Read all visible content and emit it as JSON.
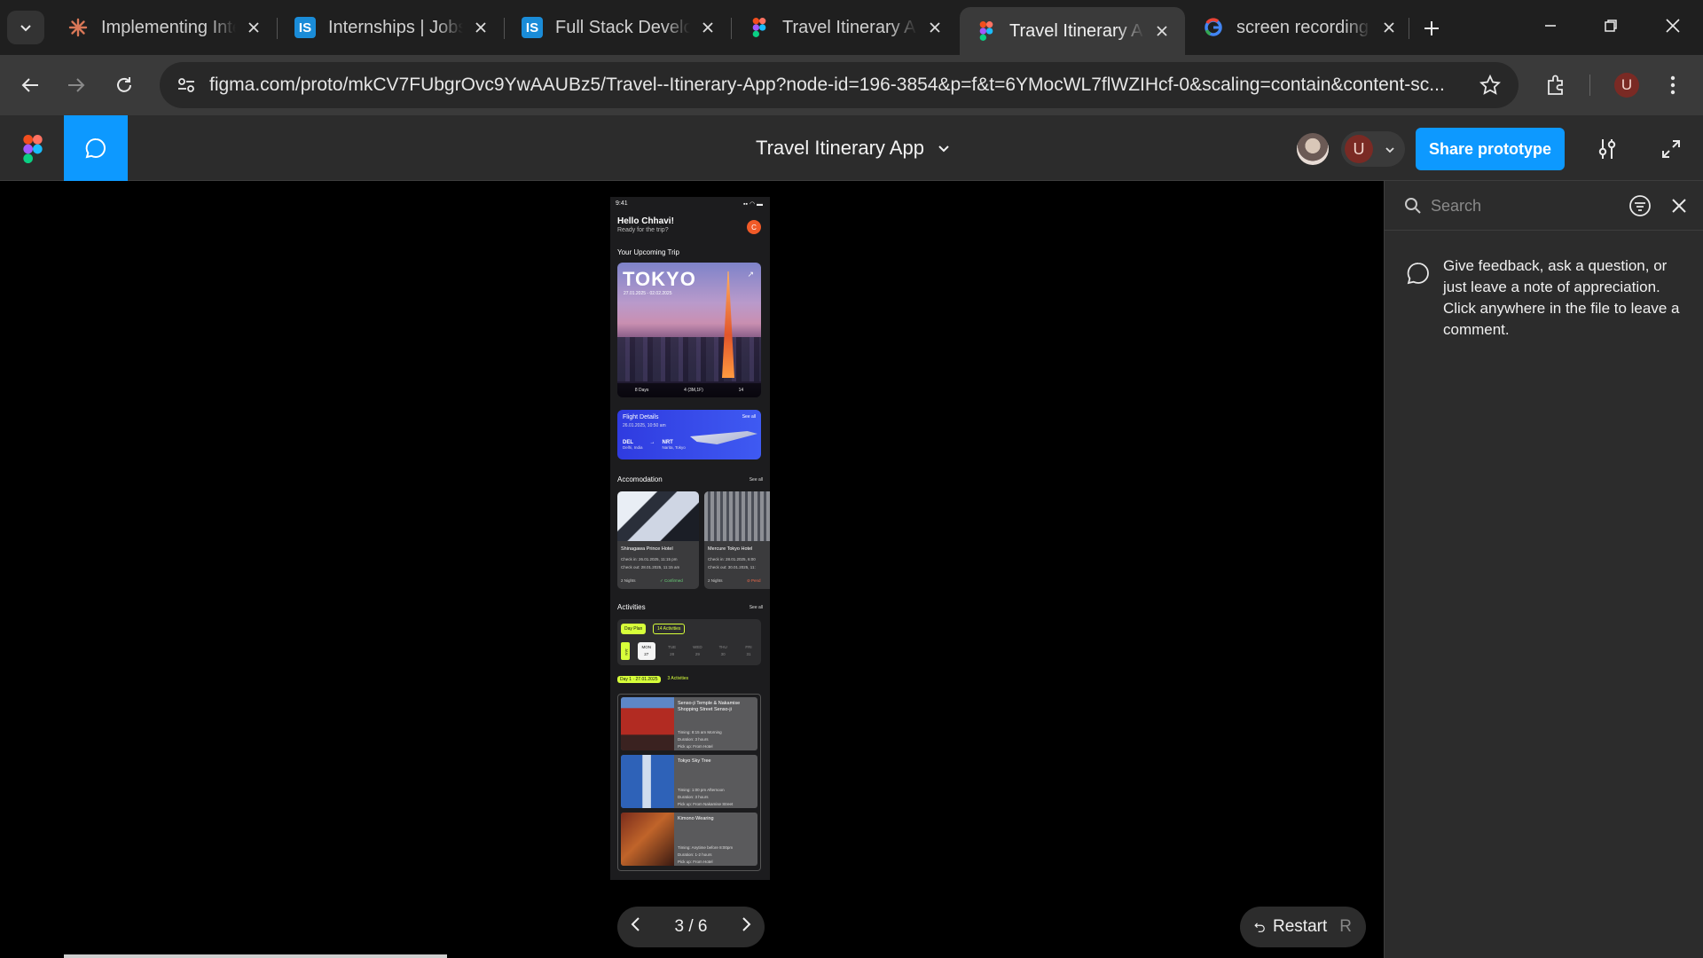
{
  "browser": {
    "tabs": [
      {
        "title": "Implementing Inte",
        "favicon": "claude-icon",
        "active": false
      },
      {
        "title": "Internships | Jobs |",
        "favicon": "internshala-icon",
        "active": false
      },
      {
        "title": "Full Stack Develop",
        "favicon": "internshala-icon",
        "active": false
      },
      {
        "title": "Travel Itinerary Ap",
        "favicon": "figma-icon",
        "active": false
      },
      {
        "title": "Travel Itinerary Ap",
        "favicon": "figma-icon",
        "active": true
      },
      {
        "title": "screen recording i",
        "favicon": "google-icon",
        "active": false
      }
    ],
    "url": "figma.com/proto/mkCV7FUbgrOvc9YwAAUBz5/Travel--Itinerary-App?node-id=196-3854&p=f&t=6YMocWL7flWZIHcf-0&scaling=contain&content-sc...",
    "profile_initial": "U"
  },
  "figma": {
    "title": "Travel Itinerary App",
    "share_label": "Share prototype",
    "user_initial": "U",
    "accent": "#0d99ff"
  },
  "prototype": {
    "status_time": "9:41",
    "greeting": "Hello Chhavi!",
    "greeting_sub": "Ready for the trip?",
    "avatar_initial": "C",
    "upcoming_label": "Your Upcoming Trip",
    "trip_city": "TOKYO",
    "trip_dates": "27.01.2025 - 02.02.2025",
    "trip_stats": [
      "8 Days",
      "4 (3M,1F)",
      "14"
    ],
    "flight": {
      "title": "Flight Details",
      "see_all": "See all",
      "datetime": "26.01.2025, 10:50 am",
      "from_code": "DEL",
      "from_city": "Delhi, India",
      "to_code": "NRT",
      "to_city": "Narita, Tokyo"
    },
    "accommodation": {
      "title": "Accomodation",
      "see_all": "See all",
      "hotels": [
        {
          "name": "Shinagawa Prince Hotel",
          "check_in": "Check in: 26.01.2025, 11:15 pm",
          "check_out": "Check out: 28.01.2025, 11:15 am",
          "nights": "2 Nights",
          "status": "Confirmed"
        },
        {
          "name": "Mercure Tokyo Hotel",
          "check_in": "Check in: 28.01.2025, 6:00",
          "check_out": "Check out: 30.01.2025, 11:",
          "nights": "2 Nights",
          "status": "Pend"
        }
      ]
    },
    "activities": {
      "title": "Activities",
      "see_all": "See all",
      "tab_day_plan": "Day Plan",
      "tab_count": "14 Activities",
      "days": [
        {
          "dow": "MON",
          "num": "27"
        },
        {
          "dow": "TUE",
          "num": "28"
        },
        {
          "dow": "WED",
          "num": "29"
        },
        {
          "dow": "THU",
          "num": "30"
        },
        {
          "dow": "FRI",
          "num": "31"
        }
      ],
      "month_label": "JAN",
      "day_label": "Day 1 · 27.01.2025",
      "day_count": "3 Activities",
      "items": [
        {
          "name": "Senso-ji Temple & Nakamise Shopping Street Senso-ji",
          "timing": "Timing: 8:15 am Morning",
          "duration": "Duration: 3 hours",
          "pickup": "Pick up: From Hotel"
        },
        {
          "name": "Tokyo Sky Tree",
          "timing": "Timing: 1:00 pm Afternoon",
          "duration": "Duration: 3 hours",
          "pickup": "Pick up: From Nakamise Street"
        },
        {
          "name": "Kimono Wearing",
          "timing": "Timing: Anytime before 8:00pm",
          "duration": "Duration: 1-2 hours",
          "pickup": "Pick up: From Hotel"
        }
      ]
    }
  },
  "pager": {
    "label": "3 / 6"
  },
  "restart": {
    "label": "Restart",
    "shortcut": "R"
  },
  "comments": {
    "search_placeholder": "Search",
    "hint": "Give feedback, ask a question, or just leave a note of appreciation. Click anywhere in the file to leave a comment."
  }
}
